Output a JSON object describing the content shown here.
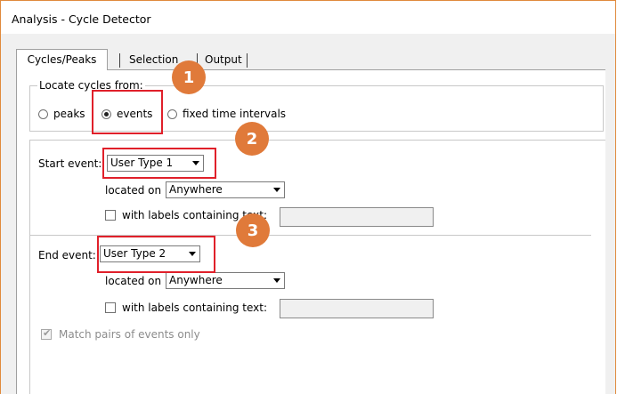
{
  "window": {
    "title": "Analysis - Cycle Detector"
  },
  "tabs": [
    {
      "label": "Cycles/Peaks",
      "active": true
    },
    {
      "label": "Selection",
      "active": false
    },
    {
      "label": "Output",
      "active": false
    }
  ],
  "locate_cycles": {
    "legend": "Locate cycles from:",
    "options": [
      {
        "label": "peaks",
        "selected": false
      },
      {
        "label": "events",
        "selected": true
      },
      {
        "label": "fixed time intervals",
        "selected": false
      }
    ]
  },
  "start_event": {
    "label": "Start event:",
    "value": "User Type 1",
    "located_on_label": "located on",
    "located_on_value": "Anywhere",
    "labels_checkbox_label": "with labels containing text:",
    "labels_checked": false,
    "labels_text": ""
  },
  "end_event": {
    "label": "End event:",
    "value": "User Type 2",
    "located_on_label": "located on",
    "located_on_value": "Anywhere",
    "labels_checkbox_label": "with labels containing text:",
    "labels_checked": false,
    "labels_text": ""
  },
  "match_pairs": {
    "label": "Match pairs of events only",
    "checked": true,
    "disabled": true
  },
  "callouts": [
    "1",
    "2",
    "3"
  ],
  "colors": {
    "callout": "#e07a3a",
    "highlight": "#e0202a",
    "window_border": "#e08a3c"
  }
}
